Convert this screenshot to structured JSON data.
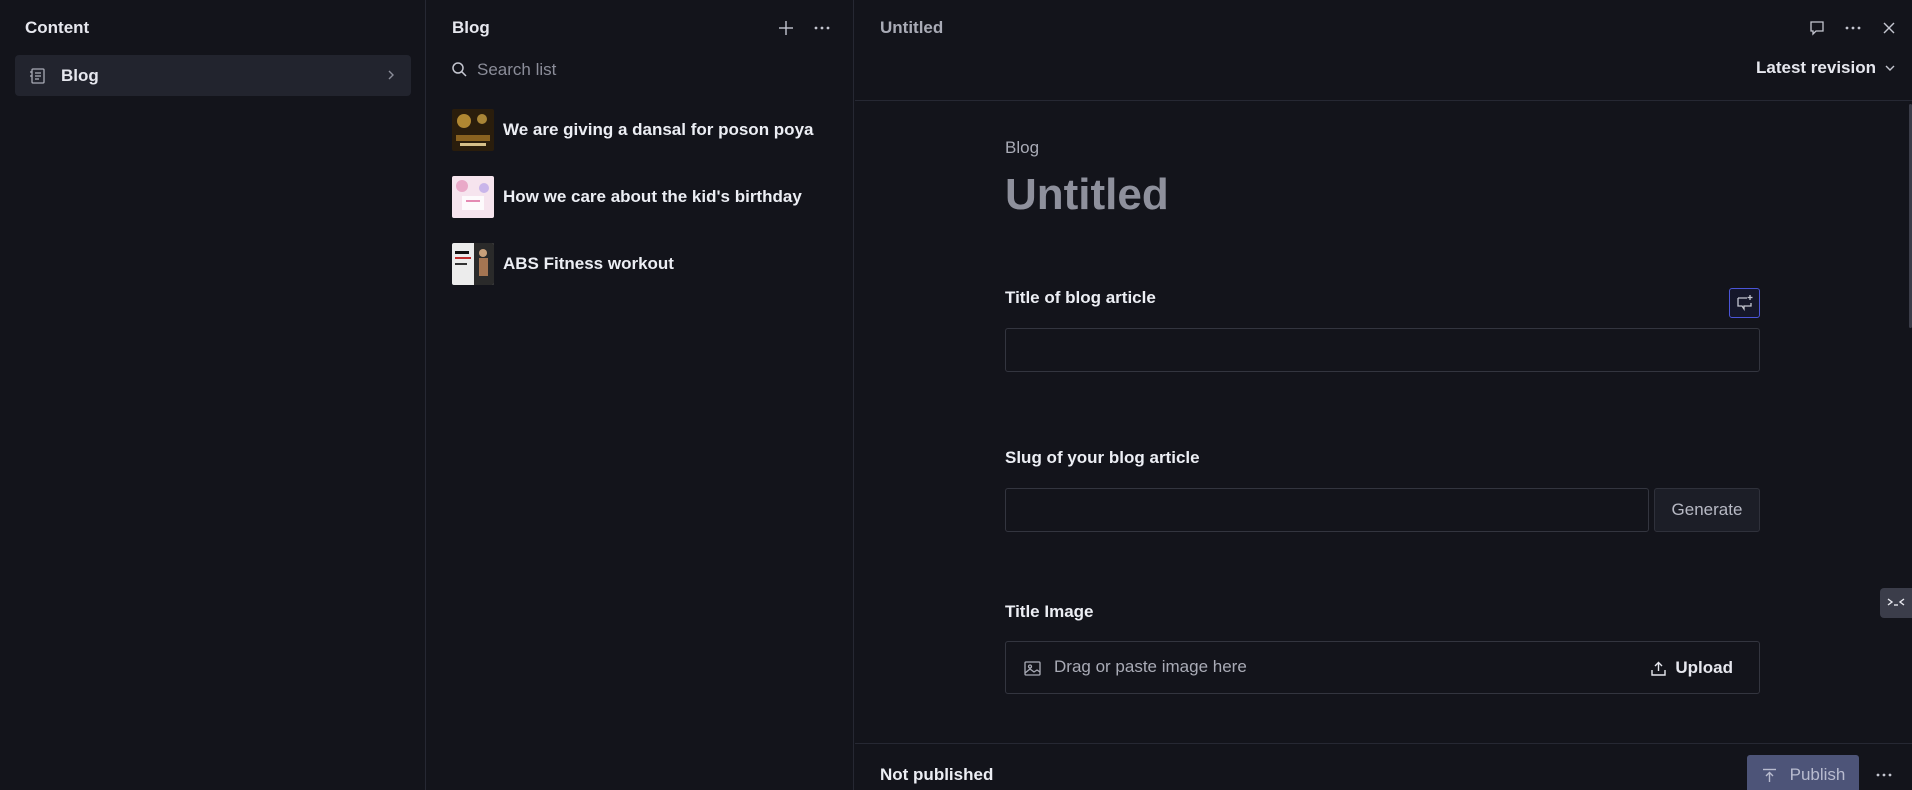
{
  "content_pane": {
    "title": "Content",
    "nav_items": [
      {
        "label": "Blog",
        "icon": "document-list-icon"
      }
    ]
  },
  "list_pane": {
    "title": "Blog",
    "create_icon": "plus-icon",
    "menu_icon": "ellipsis-icon",
    "search": {
      "placeholder": "Search list",
      "value": ""
    },
    "items": [
      {
        "title": "We are giving a dansal for poson poya",
        "thumb_color": "#3a2a12",
        "thumb_accent": "#c89a3a"
      },
      {
        "title": "How we care about the kid's birthday",
        "thumb_color": "#f3dbe8",
        "thumb_accent": "#e9a9c8"
      },
      {
        "title": "ABS Fitness workout",
        "thumb_color": "#e8e8e8",
        "thumb_accent": "#222222"
      }
    ]
  },
  "editor": {
    "tab_title": "Untitled",
    "header_icons": [
      "comment-icon",
      "ellipsis-icon",
      "close-icon"
    ],
    "revision_label": "Latest revision",
    "doc_type": "Blog",
    "doc_title": "Untitled",
    "fields": {
      "title": {
        "label": "Title of blog article",
        "value": ""
      },
      "slug": {
        "label": "Slug of your blog article",
        "value": "",
        "generate_label": "Generate"
      },
      "title_image": {
        "label": "Title Image",
        "drop_text": "Drag or paste image here",
        "upload_label": "Upload"
      }
    },
    "footer": {
      "status": "Not published",
      "publish_label": "Publish"
    }
  },
  "colors": {
    "background": "#13141b",
    "accent_focus": "#4b55d8",
    "publish_bg": "#4d5478"
  }
}
